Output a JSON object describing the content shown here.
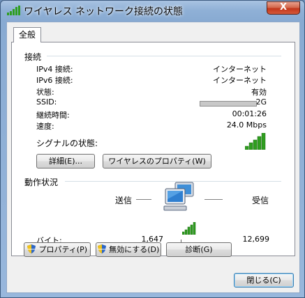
{
  "window": {
    "title": "ワイヤレス ネットワーク接続の状態",
    "close_label": "X"
  },
  "tabs": [
    {
      "label": "全般",
      "selected": true
    }
  ],
  "connection": {
    "heading": "接続",
    "rows": [
      {
        "label": "IPv4 接続:",
        "value": "インターネット"
      },
      {
        "label": "IPv6 接続:",
        "value": "インターネット"
      },
      {
        "label": "状態:",
        "value": "有効"
      },
      {
        "label": "SSID:",
        "value": "-2G"
      },
      {
        "label": "継続時間:",
        "value": "00:01:26"
      },
      {
        "label": "速度:",
        "value": "24.0 Mbps"
      }
    ],
    "signal_label": "シグナルの状態:",
    "signal_bars": 5,
    "details_button": "詳細(E)...",
    "wireless_props_button": "ワイヤレスのプロパティ(W)"
  },
  "activity": {
    "heading": "動作状況",
    "sent_label": "送信",
    "received_label": "受信",
    "bytes_label": "バイト:",
    "bytes_sent": "1,647",
    "bytes_received": "12,699"
  },
  "buttons": {
    "properties": "プロパティ(P)",
    "disable": "無効にする(D)",
    "diagnose": "診断(G)",
    "close": "閉じる(C)"
  },
  "colors": {
    "signal_green": "#2f9e1f",
    "title_gradient_top": "#a9c3e2",
    "close_red": "#c2361c"
  }
}
